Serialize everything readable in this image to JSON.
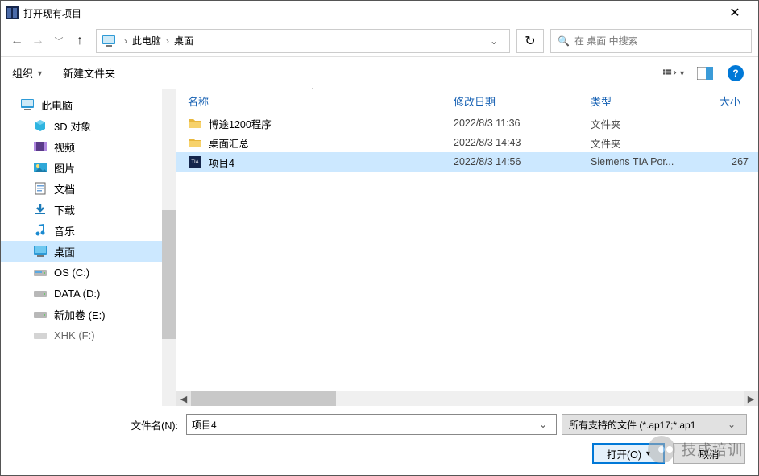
{
  "title": "打开现有项目",
  "breadcrumb": {
    "pc_label": "此电脑",
    "desktop_label": "桌面"
  },
  "search_placeholder": "在 桌面 中搜索",
  "toolbar": {
    "organize": "组织",
    "new_folder": "新建文件夹"
  },
  "tree": {
    "this_pc": "此电脑",
    "objects_3d": "3D 对象",
    "videos": "视频",
    "pictures": "图片",
    "documents": "文档",
    "downloads": "下载",
    "music": "音乐",
    "desktop": "桌面",
    "os_c": "OS (C:)",
    "data_d": "DATA (D:)",
    "new_e": "新加卷 (E:)",
    "xhk_f": "XHK (F:)"
  },
  "columns": {
    "name": "名称",
    "date": "修改日期",
    "type": "类型",
    "size": "大小"
  },
  "files": [
    {
      "name": "博途1200程序",
      "date": "2022/8/3 11:36",
      "type": "文件夹",
      "size": "",
      "kind": "folder"
    },
    {
      "name": "桌面汇总",
      "date": "2022/8/3 14:43",
      "type": "文件夹",
      "size": "",
      "kind": "folder"
    },
    {
      "name": "项目4",
      "date": "2022/8/3 14:56",
      "type": "Siemens TIA Por...",
      "size": "267",
      "kind": "tia"
    }
  ],
  "selected_index": 2,
  "filename_label": "文件名(N):",
  "filename_value": "项目4",
  "filter_label": "所有支持的文件 (*.ap17;*.ap1",
  "buttons": {
    "open": "打开(O)",
    "cancel": "取消"
  },
  "watermark": "技成培训"
}
